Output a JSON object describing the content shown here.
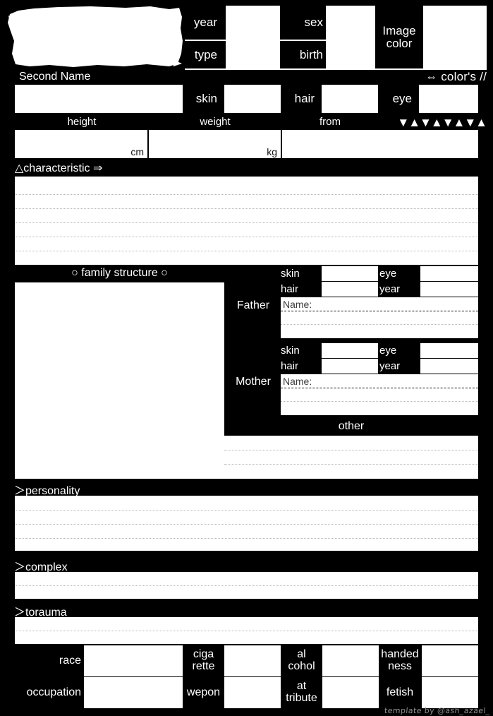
{
  "header": {
    "name_placeholder": "",
    "second_name_label": "Second Name",
    "colors_note": "⇔ color's //",
    "triangles": "▼▲▼▲▼▲▼▲",
    "fields": {
      "year_label": "year",
      "year_value": "",
      "sex_label": "sex",
      "sex_value": "",
      "type_label": "type",
      "type_value": "",
      "birth_label": "birth",
      "birth_value": "",
      "image_color_label": "Image\ncolor",
      "image_color_value": "",
      "skin_label": "skin",
      "skin_value": "",
      "hair_label": "hair",
      "hair_value": "",
      "eye_label": "eye",
      "eye_value": ""
    },
    "metrics": {
      "height_label": "height",
      "height_value": "",
      "height_unit": "cm",
      "weight_label": "weight",
      "weight_value": "",
      "weight_unit": "kg",
      "from_label": "from",
      "from_value": ""
    }
  },
  "characteristic": {
    "heading": "△characteristic ⇒",
    "value": "",
    "rule_count": 5
  },
  "family": {
    "heading": "○ family structure ○",
    "image_value": "",
    "father": {
      "label": "Father",
      "skin_label": "skin",
      "skin_value": "",
      "eye_label": "eye",
      "eye_value": "",
      "hair_label": "hair",
      "hair_value": "",
      "year_label": "year",
      "year_value": "",
      "name_label": "Name:",
      "name_value": "",
      "notes_value": ""
    },
    "mother": {
      "label": "Mother",
      "skin_label": "skin",
      "skin_value": "",
      "eye_label": "eye",
      "eye_value": "",
      "hair_label": "hair",
      "hair_value": "",
      "year_label": "year",
      "year_value": "",
      "name_label": "Name:",
      "name_value": "",
      "notes_value": ""
    },
    "other": {
      "label": "other",
      "value": ""
    }
  },
  "sections": [
    {
      "heading": "＞personality",
      "value": "",
      "rule_count": 3
    },
    {
      "heading": "＞complex",
      "value": "",
      "rule_count": 1
    },
    {
      "heading": "＞torauma",
      "value": "",
      "rule_count": 1
    }
  ],
  "bottom_table": {
    "row1": {
      "race_label": "race",
      "race_value": "",
      "cigarette_label": "ciga\nrette",
      "cigarette_value": "",
      "alcohol_label": "al\ncohol",
      "alcohol_value": "",
      "handedness_label": "handed\nness",
      "handedness_value": ""
    },
    "row2": {
      "occupation_label": "occupation",
      "occupation_value": "",
      "wepon_label": "wepon",
      "wepon_value": "",
      "attribute_label": "at\ntribute",
      "attribute_value": "",
      "fetish_label": "fetish",
      "fetish_value": ""
    }
  },
  "credit": "template by @ash_azael_",
  "colors": {
    "background": "#000000",
    "field": "#ffffff",
    "text": "#ffffff",
    "rule": "#b8b8b8",
    "credit_text": "#8e8e8e"
  }
}
